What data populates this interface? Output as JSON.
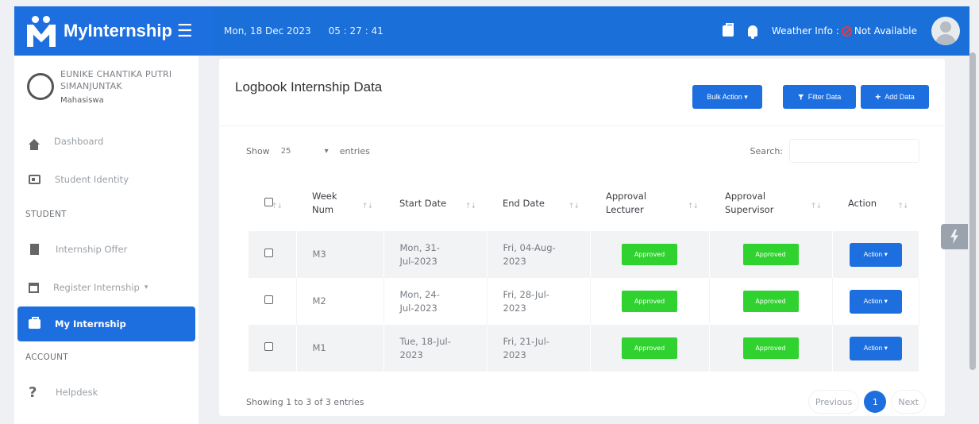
{
  "topbar": {
    "brand": "MyInternship",
    "date": "Mon, 18 Dec 2023",
    "time": "05 : 27 : 41",
    "weather_label": "Weather Info : ",
    "weather_value": "Not Available",
    "icons": [
      "hamburger-icon",
      "briefcase-icon",
      "bell-icon",
      "ban-icon",
      "avatar"
    ]
  },
  "sidebar": {
    "user_name": "EUNIKE CHANTIKA PUTRI SIMANJUNTAK",
    "user_role": "Mahasiswa",
    "items": [
      {
        "label": "Dashboard",
        "icon": "home-icon"
      },
      {
        "label": "Student Identity",
        "icon": "id-card-icon"
      }
    ],
    "section_student": "STUDENT",
    "student_items": [
      {
        "label": "Internship Offer",
        "icon": "document-icon"
      },
      {
        "label": "Register Internship",
        "icon": "calendar-icon",
        "caret": "▾"
      },
      {
        "label": "My Internship",
        "icon": "briefcase-icon",
        "active": true
      }
    ],
    "section_account": "ACCOUNT",
    "account_items": [
      {
        "label": "Helpdesk",
        "icon": "question-icon"
      }
    ]
  },
  "card": {
    "title": "Logbook Internship Data",
    "bulk_action": "Bulk Action",
    "filter_data": "Filter Data",
    "add_data": "Add Data",
    "show_label": "Show",
    "entries_value": "25",
    "entries_label": "entries",
    "search_label": "Search:",
    "columns": [
      "",
      "Week Num",
      "Start Date",
      "End Date",
      "Approval Lecturer",
      "Approval Supervisor",
      "Action"
    ],
    "rows": [
      {
        "week": "M3",
        "start": "Mon, 31-Jul-2023",
        "end": "Fri, 04-Aug-2023",
        "lecturer": "Approved",
        "supervisor": "Approved",
        "action": "Action"
      },
      {
        "week": "M2",
        "start": "Mon, 24-Jul-2023",
        "end": "Fri, 28-Jul-2023",
        "lecturer": "Approved",
        "supervisor": "Approved",
        "action": "Action"
      },
      {
        "week": "M1",
        "start": "Tue, 18-Jul-2023",
        "end": "Fri, 21-Jul-2023",
        "lecturer": "Approved",
        "supervisor": "Approved",
        "action": "Action"
      }
    ],
    "showing": "Showing 1 to 3 of 3 entries",
    "previous": "Previous",
    "current_page": "1",
    "next": "Next"
  },
  "colors": {
    "primary": "#1d6fe0",
    "approved": "#2fd22f",
    "weather_ban": "#e23b3b"
  }
}
